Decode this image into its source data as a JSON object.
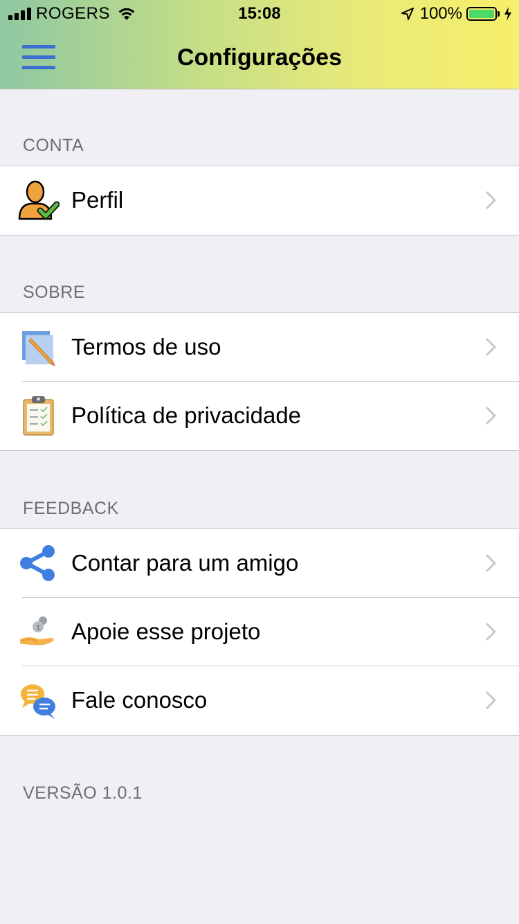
{
  "status_bar": {
    "carrier": "ROGERS",
    "time": "15:08",
    "battery_percent": "100%",
    "battery_level": 1.0,
    "battery_color": "#4cd964"
  },
  "header": {
    "title": "Configurações",
    "menu_icon": "hamburger-menu-icon",
    "accent": "#3a6fd0",
    "gradient": [
      "#8fc8a2",
      "#f6ef6a"
    ]
  },
  "sections": [
    {
      "header": "CONTA",
      "items": [
        {
          "label": "Perfil",
          "icon": "profile-user-check-icon"
        }
      ]
    },
    {
      "header": "SOBRE",
      "items": [
        {
          "label": "Termos de uso",
          "icon": "document-pencil-icon"
        },
        {
          "label": "Política de privacidade",
          "icon": "clipboard-checklist-icon"
        }
      ]
    },
    {
      "header": "FEEDBACK",
      "items": [
        {
          "label": "Contar para um amigo",
          "icon": "share-icon"
        },
        {
          "label": "Apoie esse projeto",
          "icon": "donate-coins-hand-icon"
        },
        {
          "label": "Fale conosco",
          "icon": "chat-bubbles-icon"
        }
      ]
    }
  ],
  "footer": {
    "version": "VERSÃO 1.0.1"
  }
}
